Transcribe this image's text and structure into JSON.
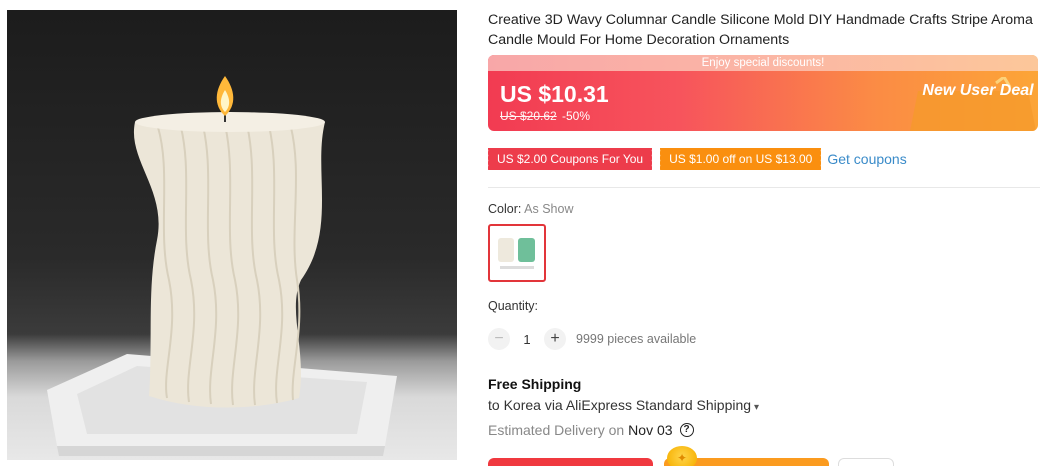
{
  "product": {
    "title": "Creative 3D Wavy Columnar Candle Silicone Mold DIY Handmade Crafts Stripe Aroma Candle Mould For Home Decoration Ornaments",
    "image_alt": "wavy ribbed pillar candle on a white square tray"
  },
  "price_banner": {
    "discount_strip": "Enjoy special discounts!",
    "price": "US $10.31",
    "old_price": "US $20.62",
    "discount_pct": "-50%",
    "deal_label": "New User Deal"
  },
  "coupons": {
    "items": [
      {
        "label": "US $2.00 Coupons For You",
        "color": "#ed3c4b"
      },
      {
        "label": "US $1.00 off on US $13.00",
        "color": "#fa8f0f"
      }
    ],
    "get_coupons_label": "Get coupons"
  },
  "color": {
    "label": "Color:",
    "value": "As Show"
  },
  "quantity": {
    "label": "Quantity:",
    "value": "1",
    "minus": "−",
    "plus": "+",
    "available": "9999 pieces available"
  },
  "shipping": {
    "title": "Free Shipping",
    "method": "to Korea via AliExpress Standard Shipping",
    "estimated_label": "Estimated Delivery on",
    "estimated_date": "Nov 03",
    "help_icon": "?"
  },
  "colors": {
    "accent_red": "#f0393f",
    "accent_orange": "#fb9b1f",
    "link_blue": "#3a8bc9"
  }
}
